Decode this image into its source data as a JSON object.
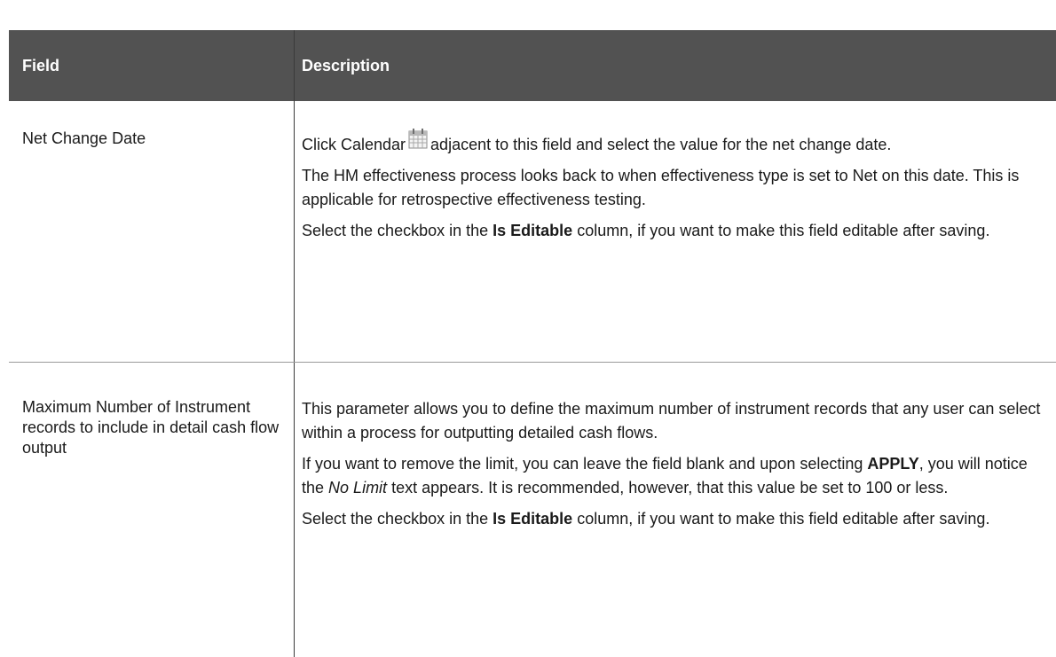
{
  "table": {
    "headers": {
      "field": "Field",
      "description": "Description"
    },
    "rows": [
      {
        "field": "Net Change Date",
        "desc": {
          "p1_before": "Click Calendar",
          "p1_after": "adjacent to this field and select the value for the net change date.",
          "p2": "The HM effectiveness process looks back to when effectiveness type is set to Net on this date. This is applicable for retrospective effectiveness testing.",
          "p3_before": "Select the checkbox in the",
          "p3_bold": "Is Editable",
          "p3_after": "column, if you want to make this field editable after saving."
        }
      },
      {
        "field": "Maximum Number of Instrument records to include in detail cash flow output",
        "desc": {
          "p1": "This parameter allows you to define the maximum number of instrument records that any user can select within a process for outputting detailed cash flows.",
          "p2_before": "If you want to remove the limit, you can leave the field blank and upon selecting",
          "p2_bold": "APPLY",
          "p2_mid": ", you will notice the",
          "p2_italic": "No Limit",
          "p2_after": "text appears. It is recommended, however, that this value be set to 100 or less.",
          "p3_before": "Select the checkbox in the",
          "p3_bold": "Is Editable",
          "p3_after": "column, if you want to make this field editable after saving."
        }
      }
    ]
  }
}
